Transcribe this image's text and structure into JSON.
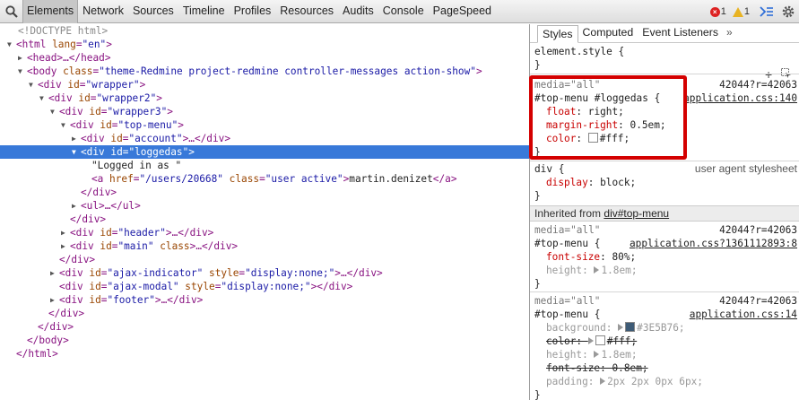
{
  "toolbar": {
    "tabs": [
      "Elements",
      "Network",
      "Sources",
      "Timeline",
      "Profiles",
      "Resources",
      "Audits",
      "Console",
      "PageSpeed"
    ],
    "error_count": "1",
    "warning_count": "1",
    "colors": {
      "error": "#dd2222",
      "warning": "#e8b322",
      "accent": "#2e6ed8"
    }
  },
  "dom": {
    "doctype": "<!DOCTYPE html>",
    "html_open": "<html",
    "html_lang_attr": "lang",
    "html_lang_val": "\"en\"",
    "head_text": "<head>…</head>",
    "body_open": "<body",
    "body_class_attr": "class",
    "body_class_val": "\"theme-Redmine project-redmine controller-messages action-show\"",
    "div": "<div",
    "id_attr": "id",
    "wrapper": "\"wrapper\"",
    "wrapper2": "\"wrapper2\"",
    "wrapper3": "\"wrapper3\"",
    "top_menu": "\"top-menu\"",
    "account": "\"account\"",
    "loggedas": "\"loggedas\"",
    "logged_text": "\"Logged in as \"",
    "a_open": "<a",
    "href_attr": "href",
    "href_val": "\"/users/20668\"",
    "class_attr": "class",
    "class_val": "\"user active\"",
    "link_text": "martin.denizet",
    "ul": "<ul>…</ul>",
    "header": "\"header\"",
    "main": "\"main\"",
    "ajax_indicator": "\"ajax-indicator\"",
    "ajax_modal": "\"ajax-modal\"",
    "footer": "\"footer\"",
    "style_attr": "style",
    "style_val": "\"display:none;\"",
    "close_div": "</div>",
    "close_body": "</body>",
    "close_html": "</html>",
    "close_a": "</a>",
    "ellipsis_close_div": "…</div>"
  },
  "styles": {
    "tabs": [
      "Styles",
      "Computed",
      "Event Listeners"
    ],
    "more": "»",
    "element_style": "element.style {",
    "close_brace": "}",
    "media_all": "media=\"all\"",
    "r1": {
      "src": "42044?r=42063",
      "src2": "application.css:140",
      "selector": "#top-menu #loggedas {",
      "props": [
        {
          "name": "float",
          "value": "right;"
        },
        {
          "name": "margin-right",
          "value": "0.5em;"
        },
        {
          "name": "color",
          "value": "#fff;",
          "swatch": "#ffffff"
        }
      ]
    },
    "r2": {
      "selector": "div {",
      "src": "user agent stylesheet",
      "prop": "display",
      "value": "block;"
    },
    "inherited_label": "Inherited from",
    "inherited_link": "div#top-menu",
    "r3": {
      "src": "42044?r=42063",
      "src2": "application.css?1361112893:8",
      "selector": "#top-menu {",
      "props": [
        {
          "name": "font-size",
          "value": "80%;"
        },
        {
          "name": "height",
          "value": "1.8em;"
        }
      ]
    },
    "r4": {
      "src": "42044?r=42063",
      "src2": "application.css:14",
      "selector": "#top-menu {",
      "props": [
        {
          "name": "background",
          "value": "#3E5B76;",
          "swatch": "#3e5b76"
        },
        {
          "name": "color",
          "value": "#fff;",
          "swatch": "#ffffff"
        },
        {
          "name": "height",
          "value": "1.8em;"
        },
        {
          "name": "font-size",
          "value": "0.8em;"
        },
        {
          "name": "padding",
          "value": "2px 2px 0px 6px;"
        }
      ]
    }
  }
}
